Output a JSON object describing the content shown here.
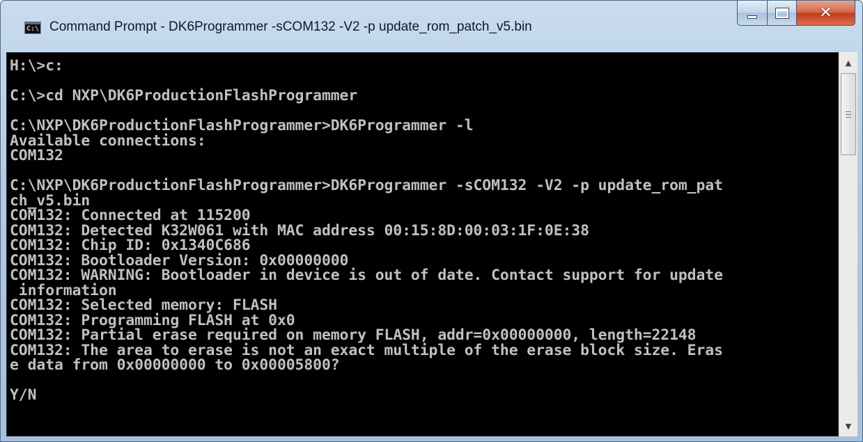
{
  "window": {
    "title": "Command Prompt - DK6Programmer  -sCOM132 -V2 -p update_rom_patch_v5.bin",
    "icon_text": "C:\\",
    "buttons": {
      "minimize": "minimize-icon",
      "maximize": "maximize-icon",
      "close": "close-icon",
      "close_glyph": "✕"
    }
  },
  "console": {
    "lines": [
      "H:\\>c:",
      "",
      "C:\\>cd NXP\\DK6ProductionFlashProgrammer",
      "",
      "C:\\NXP\\DK6ProductionFlashProgrammer>DK6Programmer -l",
      "Available connections:",
      "COM132",
      "",
      "C:\\NXP\\DK6ProductionFlashProgrammer>DK6Programmer -sCOM132 -V2 -p update_rom_pat",
      "ch_v5.bin",
      "COM132: Connected at 115200",
      "COM132: Detected K32W061 with MAC address 00:15:8D:00:03:1F:0E:38",
      "COM132: Chip ID: 0x1340C686",
      "COM132: Bootloader Version: 0x00000000",
      "COM132: WARNING: Bootloader in device is out of date. Contact support for update",
      " information",
      "COM132: Selected memory: FLASH",
      "COM132: Programming FLASH at 0x0",
      "COM132: Partial erase required on memory FLASH, addr=0x00000000, length=22148",
      "COM132: The area to erase is not an exact multiple of the erase block size. Eras",
      "e data from 0x00000000 to 0x00005800?",
      "",
      "Y/N"
    ]
  },
  "scrollbar": {
    "up_glyph": "▲",
    "down_glyph": "▼"
  }
}
